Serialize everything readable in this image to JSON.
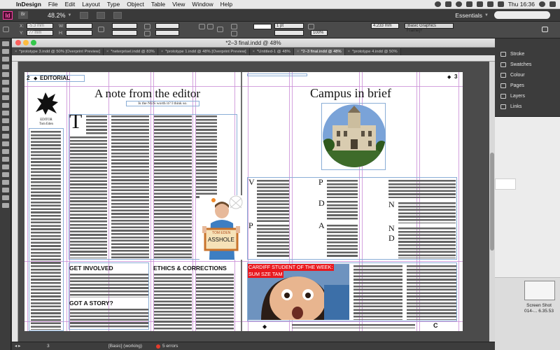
{
  "menubar": {
    "app_name": "InDesign",
    "items": [
      "File",
      "Edit",
      "Layout",
      "Type",
      "Object",
      "Table",
      "View",
      "Window",
      "Help"
    ],
    "clock": "Thu 16:36"
  },
  "appbar": {
    "logo": "Id",
    "bridge": "Br",
    "zoom": "48.2%",
    "workspace": "Essentials"
  },
  "control": {
    "x_label": "X:",
    "y_label": "Y:",
    "w_label": "W:",
    "h_label": "H:",
    "x_value": "-5.3 mm",
    "y_value": "77 mm",
    "stroke_weight": "1 pt",
    "size_value": "4.233 mm",
    "opacity": "100%",
    "frame_style": "[Basic Graphics Frame]+"
  },
  "document": {
    "title": "*2–3 final.indd @ 48%",
    "tabs": [
      {
        "label": "*prototype 3.indd @ 50% [Overprint Preview]",
        "active": false
      },
      {
        "label": "*neterprisel.indd @ 83%",
        "active": false
      },
      {
        "label": "*prototype 1.indd @ 48% [Overprint Preview]",
        "active": false
      },
      {
        "label": "*Untitled-1 @ 48%",
        "active": false
      },
      {
        "label": "*2–3 final.indd @ 48%",
        "active": true
      },
      {
        "label": "*prototype 4.indd @ 50%",
        "active": false
      }
    ],
    "status": {
      "page": "3",
      "style": "[Basic] (working)",
      "errors": "5 errors"
    }
  },
  "left_page": {
    "page_number": "2",
    "section": "EDITORIAL",
    "heading": "A note from the editor",
    "subheading": "Is the NUS worth it? I think so.",
    "sidebar_caption": "EDITOR\nTom Eden",
    "drop_cap": "T",
    "photo_sign_top": "TOM EDEN",
    "photo_sign_main": "ASSHOLE",
    "box1": "GET INVOLVED",
    "box2": "ETHICS & CORRECTIONS",
    "box3": "GOT A STORY?"
  },
  "right_page": {
    "page_number": "3",
    "heading": "Campus in brief",
    "caps_col1": [
      "V",
      "P"
    ],
    "caps_col2": [
      "P",
      "D",
      "A"
    ],
    "caps_col3": [
      "N",
      "N",
      "D"
    ],
    "feature_banner_line1": "CARDIFF STUDENT OF THE WEEK:",
    "feature_banner_line2": "SUM SZE TAM",
    "footer_mark": "C"
  },
  "panels": {
    "items": [
      "Stroke",
      "Swatches",
      "Colour",
      "Pages",
      "Layers",
      "Links"
    ]
  },
  "desktop": {
    "file_label_1": "Screen Shot",
    "file_label_2": "014-... 6.35.53"
  },
  "colors": {
    "accent_pink": "#ff3ea5",
    "guide_purple": "#c98bd6",
    "frame_blue": "#8aaed6",
    "banner_red": "#e8181e"
  }
}
